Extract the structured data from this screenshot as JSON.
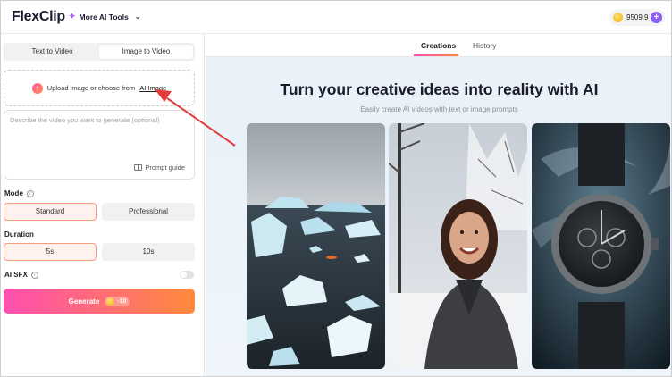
{
  "app": {
    "logo": "FlexClip",
    "ai_tools_label": "More AI Tools",
    "credits": "9509.9"
  },
  "left": {
    "mode_tabs": [
      "Text to Video",
      "Image to Video"
    ],
    "active_tab": "Image to Video",
    "upload_text": "Upload image or choose from",
    "upload_link": "AI Image",
    "prompt_placeholder": "Describe the video you want to generate (optional)",
    "prompt_value": "",
    "prompt_guide": "Prompt guide",
    "mode_label": "Mode",
    "mode_options": [
      "Standard",
      "Professional"
    ],
    "mode_selected": "Standard",
    "duration_label": "Duration",
    "duration_options": [
      "5s",
      "10s"
    ],
    "duration_selected": "5s",
    "sfx_label": "AI SFX",
    "sfx_enabled": false,
    "generate_label": "Generate",
    "generate_cost": "-10"
  },
  "right": {
    "tabs": [
      "Creations",
      "History"
    ],
    "active_tab": "Creations",
    "title": "Turn your creative ideas into reality with AI",
    "subtitle": "Easily create AI videos with text or image prompts"
  },
  "icons": [
    "sparkle-icon",
    "chevron-down-icon",
    "coin-icon",
    "plus-icon",
    "upload-icon",
    "info-icon",
    "book-icon"
  ],
  "colors": {
    "accent_gradient_start": "#ff4fb0",
    "accent_gradient_end": "#ff8a3c",
    "selected_border": "#ff9a7a",
    "annotation_arrow": "#e23b3b"
  }
}
